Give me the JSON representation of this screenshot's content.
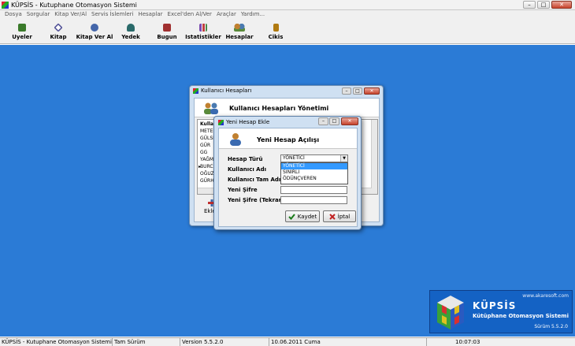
{
  "app": {
    "title": "KÜPSİS - Kutuphane Otomasyon Sistemi"
  },
  "menu": [
    "Dosya",
    "Sorgular",
    "Kitap Ver/Al",
    "Servis İslemleri",
    "Hesaplar",
    "Excel'den Al/Ver",
    "Araçlar",
    "Yardım..."
  ],
  "toolbar": [
    {
      "label": "Uyeler",
      "icon": "members-icon",
      "color": "#3a7a2a"
    },
    {
      "label": "Kitap",
      "icon": "book-icon",
      "color": "#555599"
    },
    {
      "label": "Kitap Ver Al",
      "icon": "book-lend-icon",
      "color": "#4466aa"
    },
    {
      "label": "Yedek",
      "icon": "backup-icon",
      "color": "#2a6a6a"
    },
    {
      "label": "Bugun",
      "icon": "today-icon",
      "color": "#a03030"
    },
    {
      "label": "Istatistikler",
      "icon": "statistics-icon",
      "color": "#7a4ab0"
    },
    {
      "label": "Hesaplar",
      "icon": "accounts-icon",
      "color": "#a07020"
    },
    {
      "label": "Cikis",
      "icon": "exit-icon",
      "color": "#b07a10"
    }
  ],
  "accounts_window": {
    "title": "Kullanıcı Hesapları",
    "header": "Kullanıcı Hesapları Yönetimi",
    "column_header": "Kullan",
    "rows": [
      "METEH",
      "GÜLSE",
      "GÜR",
      "GG",
      "YAĞMU",
      "BURCU",
      "OĞUZH",
      "GÜRHA"
    ],
    "add_label": "Ekle"
  },
  "new_account": {
    "title": "Yeni Hesap Ekle",
    "header": "Yeni Hesap Açılışı",
    "labels": {
      "account_type": "Hesap Türü",
      "username": "Kullanıcı Adı",
      "full_name": "Kullanıcı Tam Adı",
      "password": "Yeni Şifre",
      "password_repeat": "Yeni Şifre (Tekrar)"
    },
    "account_type_value": "YÖNETİCİ",
    "options": [
      "YÖNETİCİ",
      "SINIRLI",
      "ÖDÜNÇVEREN"
    ],
    "save": "Kaydet",
    "cancel": "İptal"
  },
  "logo": {
    "site": "www.akaresoft.com",
    "name": "KÜPSİS",
    "subtitle": "Kütüphane Otomasyon Sistemi",
    "version": "Sürüm  5.5.2.0"
  },
  "status": {
    "app": "KÜPSİS - Kutuphane Otomasyon Sistemi",
    "edition": "Tam Sürüm",
    "version": "Version 5.5.2.0",
    "date": "10.06.2011 Cuma",
    "time": "10:07:03"
  }
}
